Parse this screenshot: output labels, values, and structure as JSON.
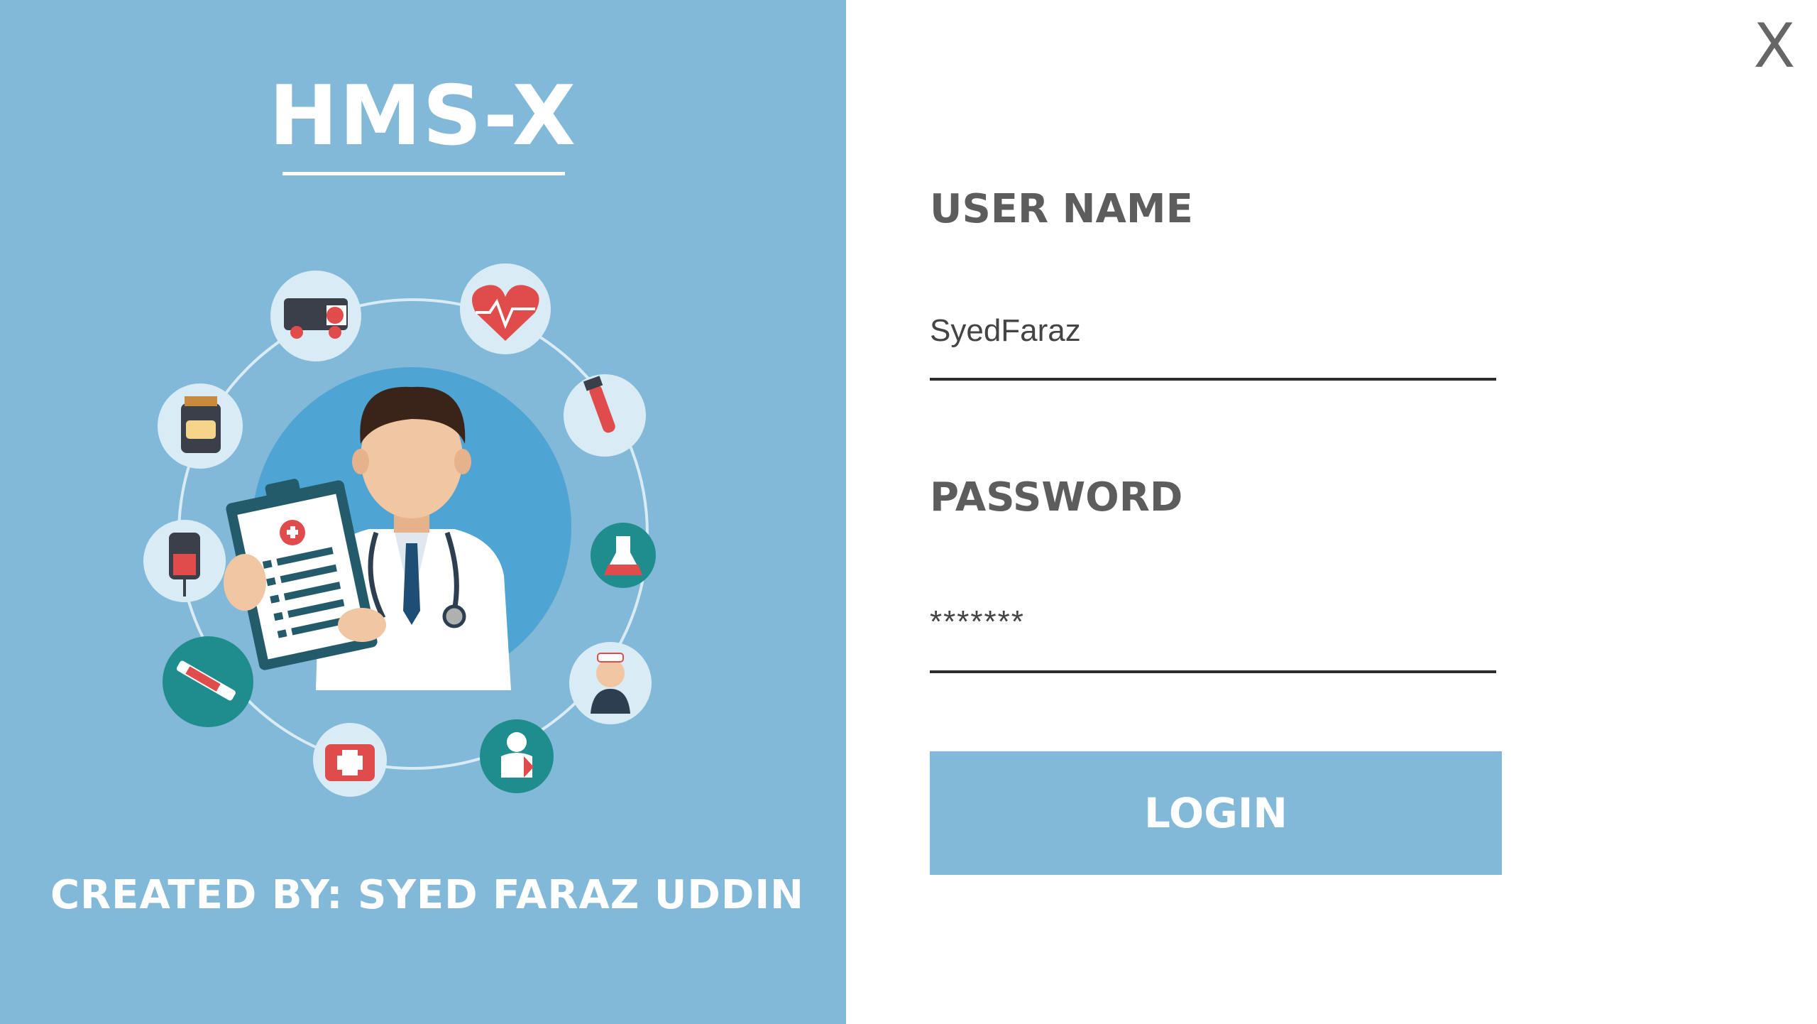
{
  "app": {
    "title": "HMS-X",
    "credit": "CREATED BY: SYED FARAZ UDDIN",
    "close_label": "X"
  },
  "login_form": {
    "username_label": "USER NAME",
    "username_value": "SyedFaraz",
    "password_label": "PASSWORD",
    "password_value": "*******",
    "login_label": "LOGIN"
  },
  "colors": {
    "panel": "#82b8d8",
    "button": "#82b8d8",
    "text_label": "#5d5d5d"
  },
  "illustration": {
    "icons": [
      "ambulance-icon",
      "heart-icon",
      "blood-sample-icon",
      "flask-icon",
      "nurse-icon",
      "patient-icon",
      "first-aid-kit-icon",
      "syringe-icon",
      "iv-bag-icon",
      "medicine-bottle-icon",
      "doctor-icon",
      "clipboard-icon"
    ]
  }
}
